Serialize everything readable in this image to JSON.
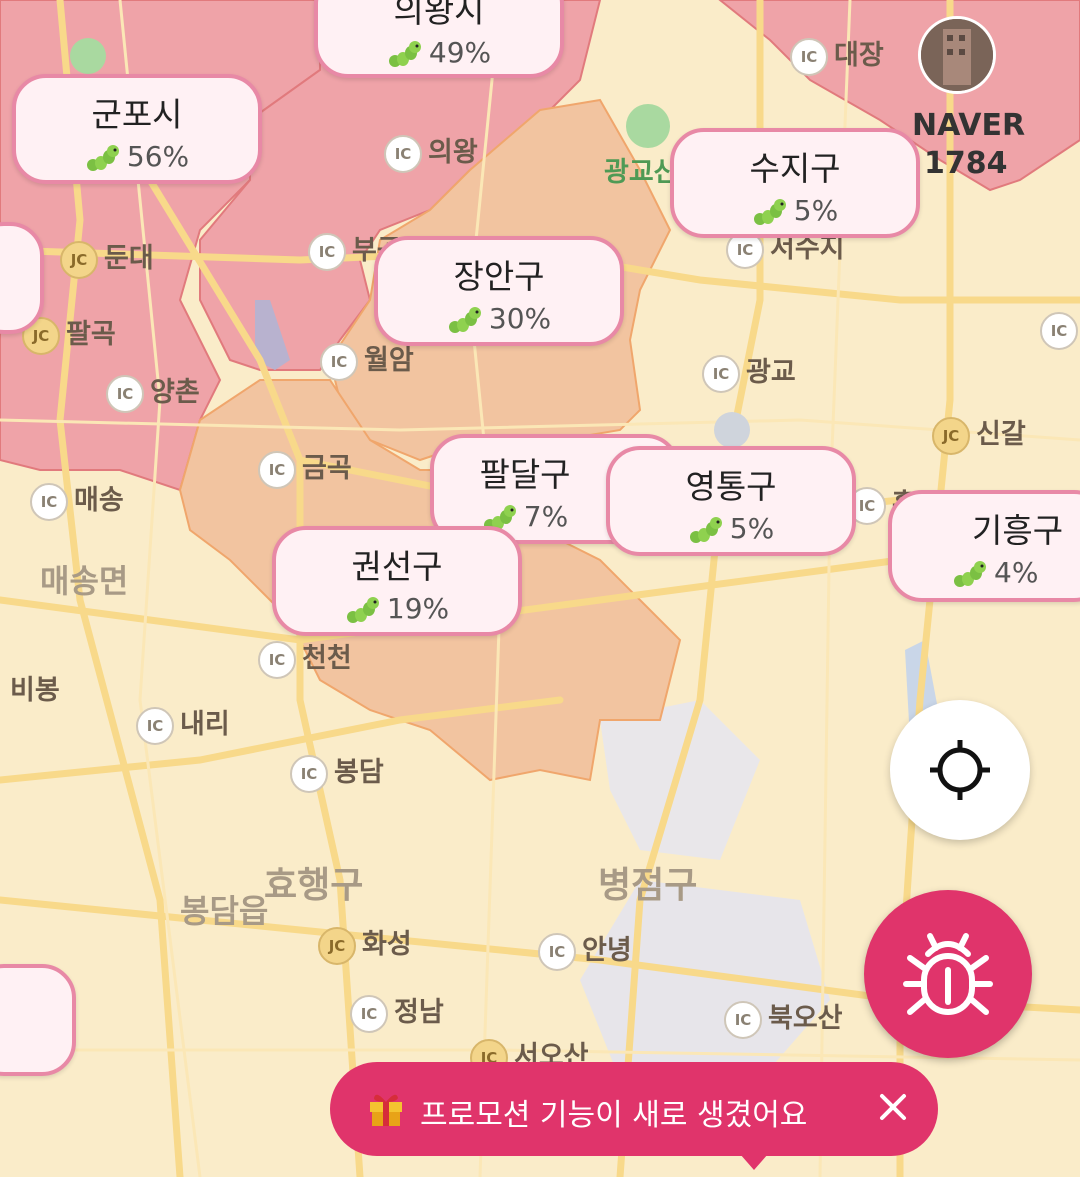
{
  "places": {
    "daejang": "대장",
    "uiwang_ic": "의왕",
    "dundae": "둔대",
    "bugok": "부곡",
    "palgok": "팔곡",
    "wolam": "월암",
    "yangchon": "양촌",
    "gwanggyo": "광교",
    "singal": "신갈",
    "geumgok": "금곡",
    "maesong": "매송",
    "maesongmyeon": "매송면",
    "cheoncheon": "천천",
    "bibong": "비봉",
    "naeri": "내리",
    "bongdam": "봉담",
    "hyohaenggu": "효행구",
    "bongdameup": "봉담읍",
    "hwaseong": "화성",
    "anyeong": "안녕",
    "byeongjeomgu": "병점구",
    "jeongnam": "정남",
    "bugosan": "북오산",
    "seoosan": "서오산",
    "gwanggyosan": "광교산",
    "suji_partial": "서수지",
    "ho_partial": "흥"
  },
  "landmark": {
    "line1": "NAVER",
    "line2": "1784"
  },
  "regions": [
    {
      "id": "uiwang",
      "name": "의왕시",
      "pct": "49%"
    },
    {
      "id": "gunpo",
      "name": "군포시",
      "pct": "56%"
    },
    {
      "id": "suji",
      "name": "수지구",
      "pct": "5%"
    },
    {
      "id": "jangan",
      "name": "장안구",
      "pct": "30%"
    },
    {
      "id": "paldal",
      "name": "팔달구",
      "pct": "7%"
    },
    {
      "id": "yeongtong",
      "name": "영통구",
      "pct": "5%"
    },
    {
      "id": "giheung",
      "name": "기흥구",
      "pct": "4%"
    },
    {
      "id": "gwonseon",
      "name": "권선구",
      "pct": "19%"
    }
  ],
  "toast": {
    "message": "프로모션 기능이 새로 생겼어요",
    "icon": "gift-icon",
    "close_icon": "close-icon"
  },
  "buttons": {
    "locate_icon": "crosshair-icon",
    "bug_icon": "bug-icon"
  },
  "colors": {
    "accent": "#e0346b",
    "bubble_border": "#e889a6",
    "bubble_bg": "#fff1f4",
    "high_region": "#efa3a8",
    "mid_region": "#f2c4a0"
  }
}
